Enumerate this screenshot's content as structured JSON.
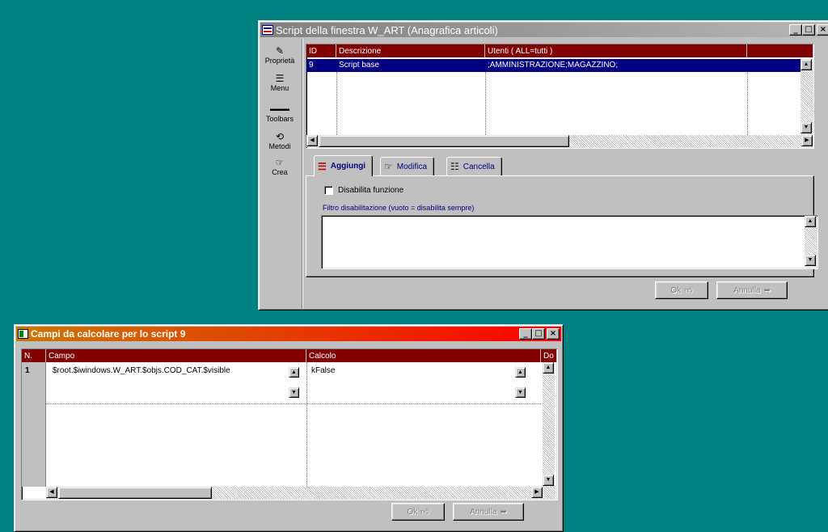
{
  "script_window": {
    "title": "Script della finestra W_ART   (Anagrafica articoli)",
    "controls": {
      "minimize": "_",
      "maximize": "□",
      "close": "×"
    },
    "sidebar": [
      {
        "label": "Proprietà",
        "icon": "wrench-icon"
      },
      {
        "label": "Menu",
        "icon": "menu-icon"
      },
      {
        "label": "Toolbars",
        "icon": "toolbar-icon"
      },
      {
        "label": "Metodi",
        "icon": "method-icon"
      },
      {
        "label": "Crea",
        "icon": "create-icon"
      }
    ],
    "grid": {
      "columns": [
        "ID",
        "Descrizione",
        "Utenti ( ALL=tutti )"
      ],
      "rows": [
        {
          "id": "9",
          "descrizione": "Script base",
          "utenti": ";AMMINISTRAZIONE;MAGAZZINO;"
        }
      ]
    },
    "tabs": [
      {
        "label": "Aggiungi",
        "icon": "add-script-icon"
      },
      {
        "label": "Modifica",
        "icon": "edit-hand-icon"
      },
      {
        "label": "Cancella",
        "icon": "delete-script-icon"
      }
    ],
    "active_tab": "Aggiungi",
    "disable_checkbox": {
      "label": "Disabilita funzione",
      "checked": false
    },
    "filter_label": "Filtro disabilitazione (vuoto = disabilita sempre)",
    "filter_value": "",
    "ok_label": "Ok",
    "cancel_label": "Annulla"
  },
  "fields_window": {
    "title": "Campi da calcolare per lo script 9",
    "controls": {
      "minimize": "_",
      "maximize": "□",
      "close": "×"
    },
    "grid": {
      "columns": [
        "N.",
        "Campo",
        "Calcolo",
        "Do"
      ],
      "rows": [
        {
          "n": "1",
          "campo": "$root.$iwindows.W_ART.$objs.COD_CAT.$visible",
          "calcolo": "kFalse"
        }
      ]
    },
    "ok_label": "Ok",
    "cancel_label": "Annulla"
  },
  "colors": {
    "desktop": "#008080",
    "title_inactive_start": "#808080",
    "title_inactive_end": "#b5b5b5",
    "title_active_start": "#c87800",
    "title_active_end": "#ff0000",
    "header_bg": "#800000",
    "selection": "#000080"
  }
}
